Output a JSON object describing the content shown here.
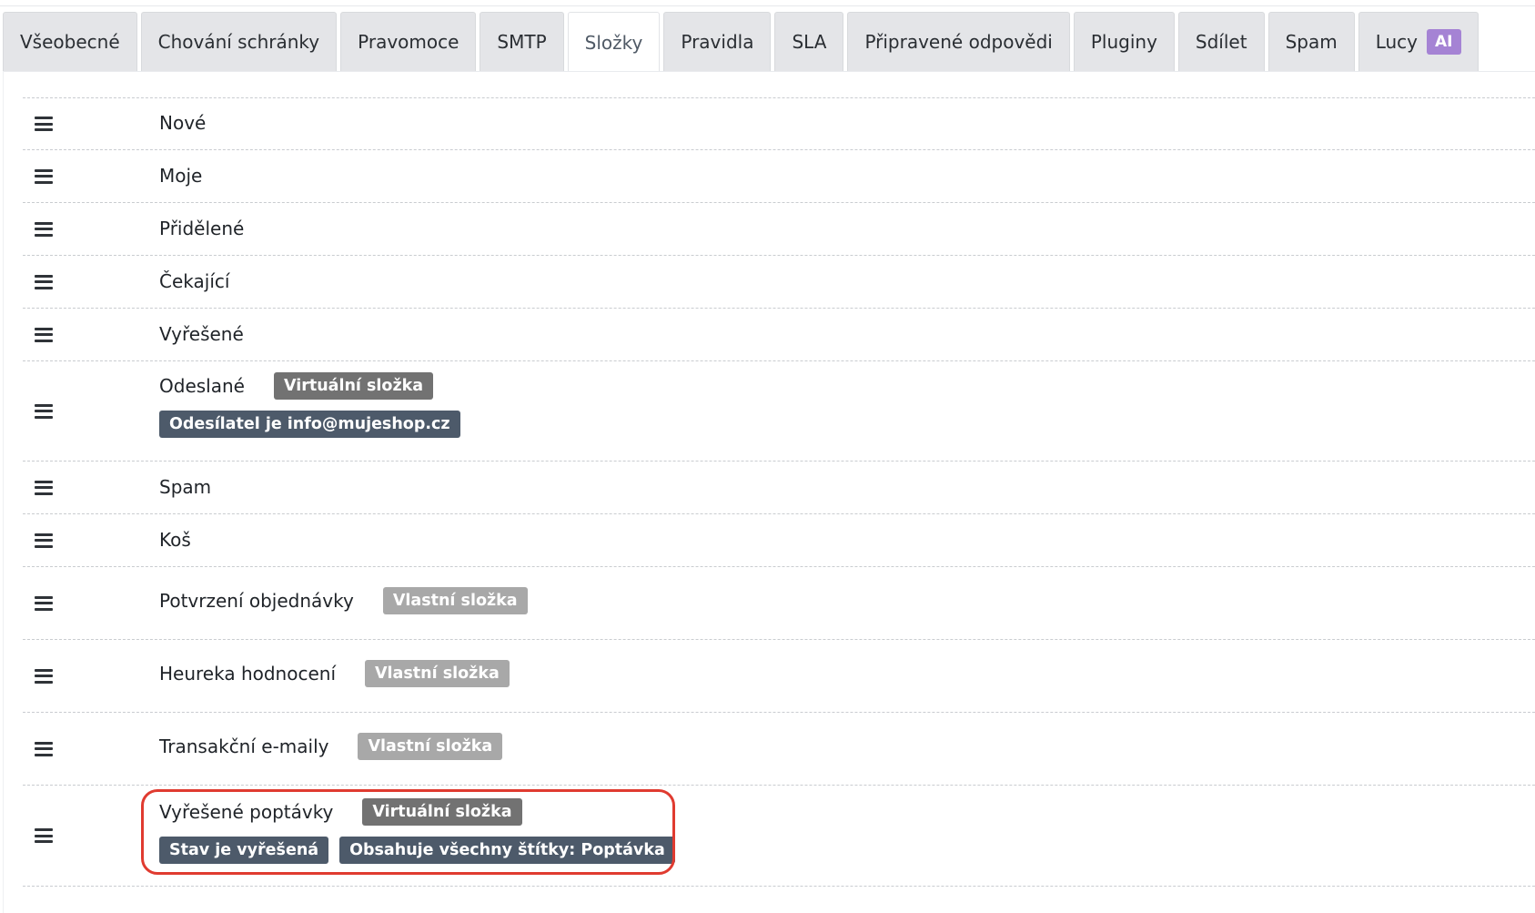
{
  "tabs": [
    {
      "label": "Všeobecné"
    },
    {
      "label": "Chování schránky"
    },
    {
      "label": "Pravomoce"
    },
    {
      "label": "SMTP"
    },
    {
      "label": "Složky"
    },
    {
      "label": "Pravidla"
    },
    {
      "label": "SLA"
    },
    {
      "label": "Připravené odpovědi"
    },
    {
      "label": "Pluginy"
    },
    {
      "label": "Sdílet"
    },
    {
      "label": "Spam"
    },
    {
      "label": "Lucy",
      "badge": "AI"
    }
  ],
  "active_tab": "Složky",
  "colors": {
    "virtual_badge": "#727272",
    "custom_badge": "#a8a8a8",
    "condition_badge": "#4d5a6a",
    "ai_badge": "#a583d4",
    "highlight": "#e03b30"
  },
  "folders": [
    {
      "name": "Nové"
    },
    {
      "name": "Moje"
    },
    {
      "name": "Přidělené"
    },
    {
      "name": "Čekající"
    },
    {
      "name": "Vyřešené"
    },
    {
      "name": "Odeslané",
      "badge": "Virtuální složka",
      "conditions": [
        "Odesílatel je info@mujeshop.cz"
      ]
    },
    {
      "name": "Spam"
    },
    {
      "name": "Koš"
    },
    {
      "name": "Potvrzení objednávky",
      "badge": "Vlastní složka"
    },
    {
      "name": "Heureka hodnocení",
      "badge": "Vlastní složka"
    },
    {
      "name": "Transakční e-maily",
      "badge": "Vlastní složka"
    },
    {
      "name": "Vyřešené poptávky",
      "badge": "Virtuální složka",
      "conditions": [
        "Stav je vyřešená",
        "Obsahuje všechny štítky: Poptávka"
      ]
    }
  ]
}
